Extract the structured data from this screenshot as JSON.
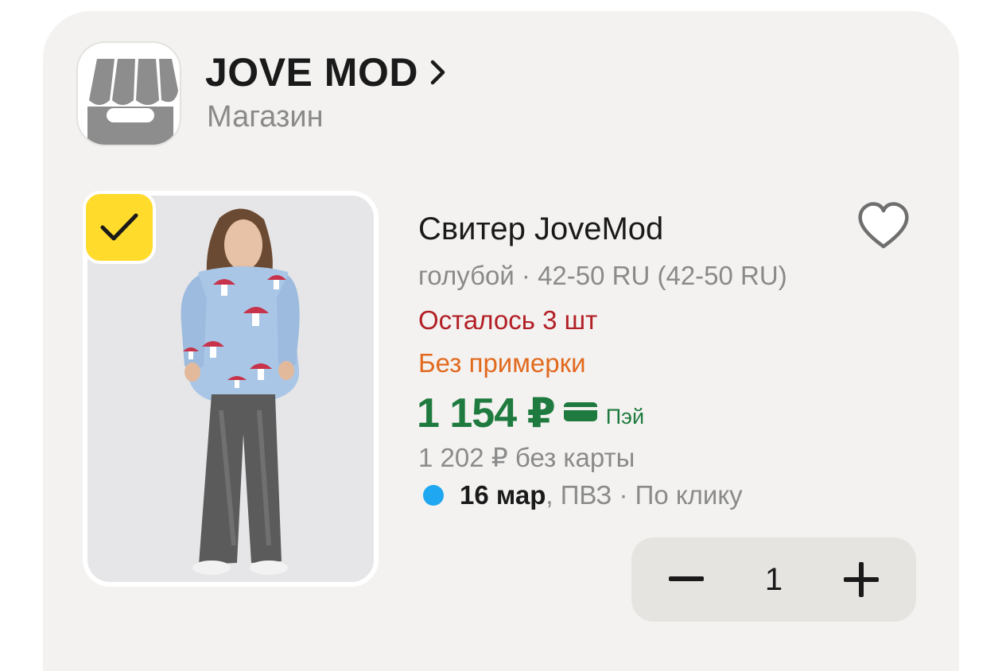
{
  "shop": {
    "name": "JOVE MOD",
    "subtitle": "Магазин"
  },
  "product": {
    "title": "Свитер JoveMod",
    "variant": "голубой · 42-50 RU (42-50 RU)",
    "stock": "Осталось 3 шт",
    "fitting": "Без примерки",
    "price": "1 154 ₽",
    "pay_label": "Пэй",
    "price_without_card": "1 202 ₽  без карты",
    "selected": true
  },
  "delivery": {
    "date": "16 мар",
    "details": ", ПВЗ · По клику"
  },
  "quantity": {
    "value": "1"
  },
  "colors": {
    "card_background": "#f3f2f0",
    "check_badge": "#ffdb2b",
    "price_green": "#1e7a3e",
    "stock_red": "#b21f25",
    "fitting_orange": "#e26a1f",
    "delivery_dot": "#1fa7f2",
    "stepper_background": "#e6e4e0"
  },
  "icons": {
    "shop": "storefront-icon",
    "chevron": "chevron-right-icon",
    "check": "checkmark-icon",
    "favorite": "heart-outline-icon",
    "pay": "card-icon",
    "delivery": "status-dot-icon",
    "minus": "minus-icon",
    "plus": "plus-icon"
  }
}
